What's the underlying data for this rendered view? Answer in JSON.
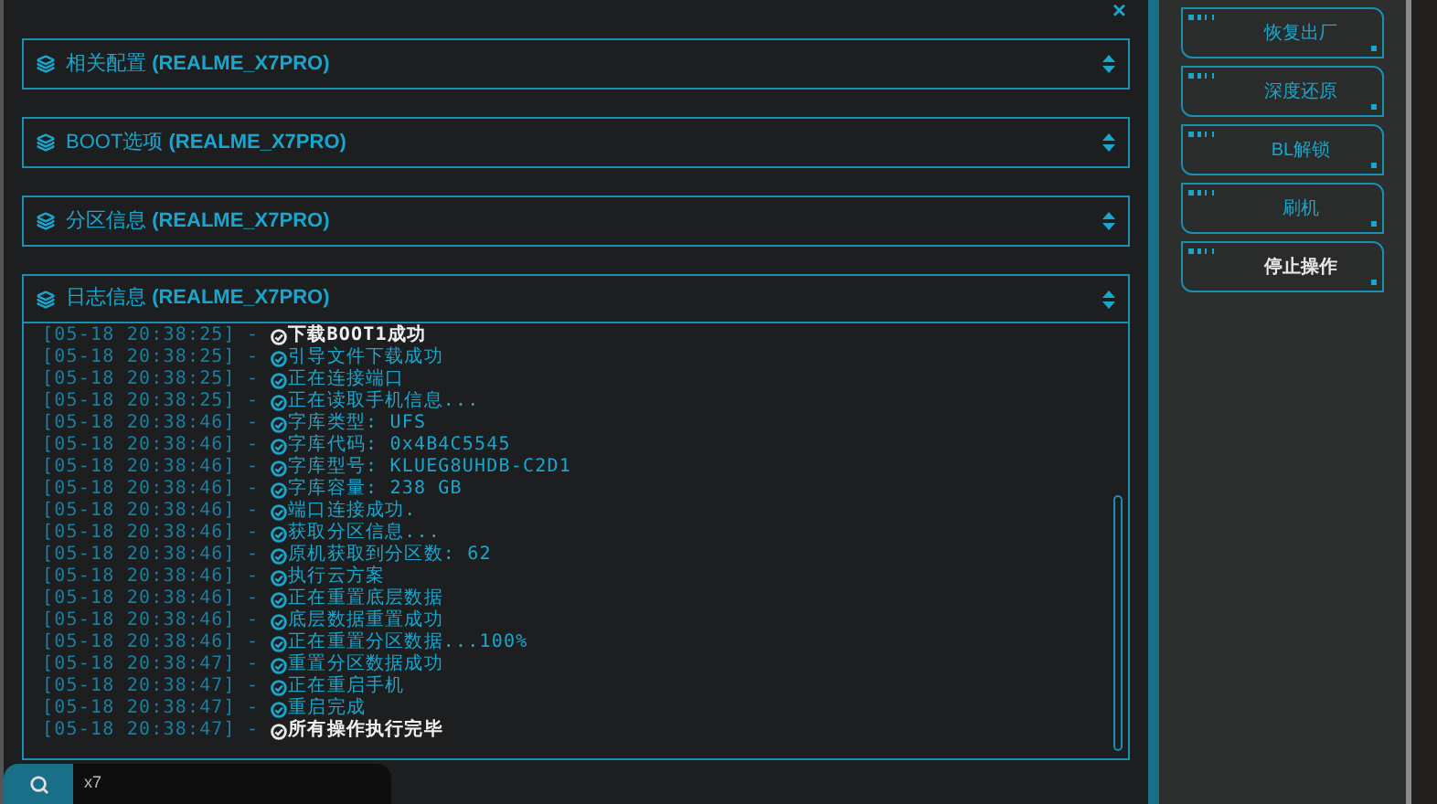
{
  "close_label": "×",
  "sections": [
    {
      "name": "相关配置",
      "device": "(REALME_X7PRO)",
      "expanded": false
    },
    {
      "name": "BOOT选项",
      "device": "(REALME_X7PRO)",
      "expanded": false
    },
    {
      "name": "分区信息",
      "device": "(REALME_X7PRO)",
      "expanded": false
    },
    {
      "name": "日志信息",
      "device": "(REALME_X7PRO)",
      "expanded": true
    }
  ],
  "log": [
    {
      "time": "[05-18 20:38:25]",
      "message": "下载BOOT1成功",
      "emphasis": true
    },
    {
      "time": "[05-18 20:38:25]",
      "message": "引导文件下载成功",
      "emphasis": false
    },
    {
      "time": "[05-18 20:38:25]",
      "message": "正在连接端口",
      "emphasis": false
    },
    {
      "time": "[05-18 20:38:25]",
      "message": "正在读取手机信息...",
      "emphasis": false
    },
    {
      "time": "[05-18 20:38:46]",
      "message": "字库类型: UFS",
      "emphasis": false
    },
    {
      "time": "[05-18 20:38:46]",
      "message": "字库代码: 0x4B4C5545",
      "emphasis": false
    },
    {
      "time": "[05-18 20:38:46]",
      "message": "字库型号: KLUEG8UHDB-C2D1",
      "emphasis": false
    },
    {
      "time": "[05-18 20:38:46]",
      "message": "字库容量: 238 GB",
      "emphasis": false
    },
    {
      "time": "[05-18 20:38:46]",
      "message": "端口连接成功.",
      "emphasis": false
    },
    {
      "time": "[05-18 20:38:46]",
      "message": "获取分区信息...",
      "emphasis": false
    },
    {
      "time": "[05-18 20:38:46]",
      "message": "原机获取到分区数: 62",
      "emphasis": false
    },
    {
      "time": "[05-18 20:38:46]",
      "message": "执行云方案",
      "emphasis": false
    },
    {
      "time": "[05-18 20:38:46]",
      "message": "正在重置底层数据",
      "emphasis": false
    },
    {
      "time": "[05-18 20:38:46]",
      "message": "底层数据重置成功",
      "emphasis": false
    },
    {
      "time": "[05-18 20:38:46]",
      "message": "正在重置分区数据...100%",
      "emphasis": false
    },
    {
      "time": "[05-18 20:38:47]",
      "message": "重置分区数据成功",
      "emphasis": false
    },
    {
      "time": "[05-18 20:38:47]",
      "message": "正在重启手机",
      "emphasis": false
    },
    {
      "time": "[05-18 20:38:47]",
      "message": "重启完成",
      "emphasis": false
    },
    {
      "time": "[05-18 20:38:47]",
      "message": "所有操作执行完毕",
      "emphasis": true
    }
  ],
  "log_separator": "-",
  "search": {
    "value": "x7"
  },
  "actions": [
    {
      "label": "恢复出厂",
      "emphasis": false
    },
    {
      "label": "深度还原",
      "emphasis": false
    },
    {
      "label": "BL解锁",
      "emphasis": false
    },
    {
      "label": "刷机",
      "emphasis": false
    },
    {
      "label": "停止操作",
      "emphasis": true
    }
  ]
}
